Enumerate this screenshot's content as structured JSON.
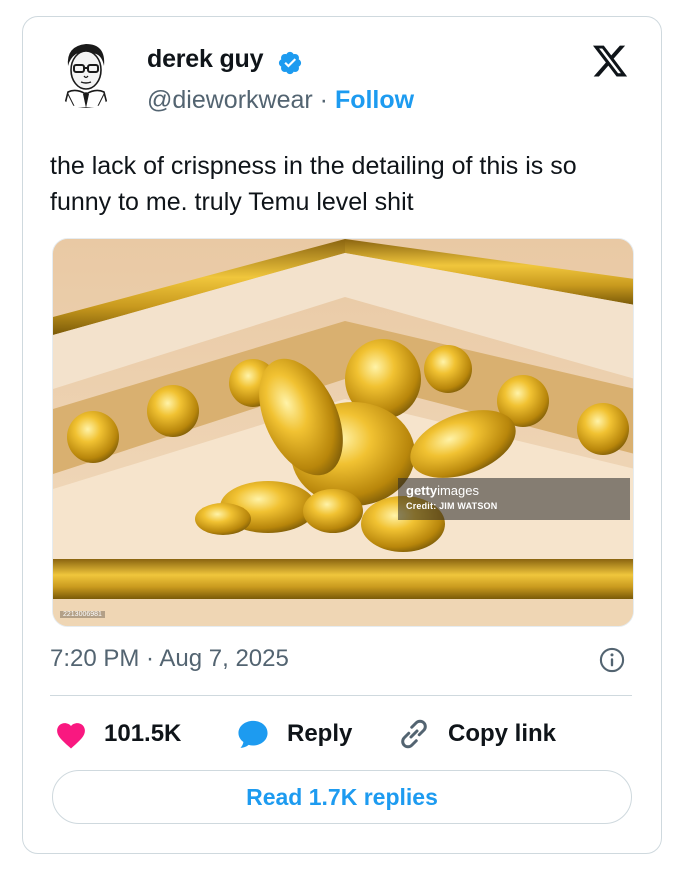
{
  "author": {
    "name": "derek guy",
    "handle": "@dieworkwear",
    "separator": " · ",
    "follow_label": "Follow",
    "verified": true
  },
  "platform_icon": "x-logo-icon",
  "tweet": {
    "text": "the lack of crispness in the detailing of this is so funny to me. truly Temu level shit"
  },
  "media": {
    "watermark_brand": "getty",
    "watermark_brand_suffix": "images",
    "watermark_credit": "Credit: JIM WATSON",
    "image_id": "2213006981"
  },
  "meta": {
    "timestamp": "7:20 PM · Aug 7, 2025"
  },
  "actions": {
    "likes": "101.5K",
    "reply_label": "Reply",
    "copy_link_label": "Copy link",
    "read_replies_label": "Read 1.7K replies"
  },
  "colors": {
    "accent": "#1d9bf0",
    "like": "#f91880",
    "text": "#0f1419",
    "muted": "#536471",
    "border": "#cfd9de",
    "gold": "#d9a81e"
  }
}
